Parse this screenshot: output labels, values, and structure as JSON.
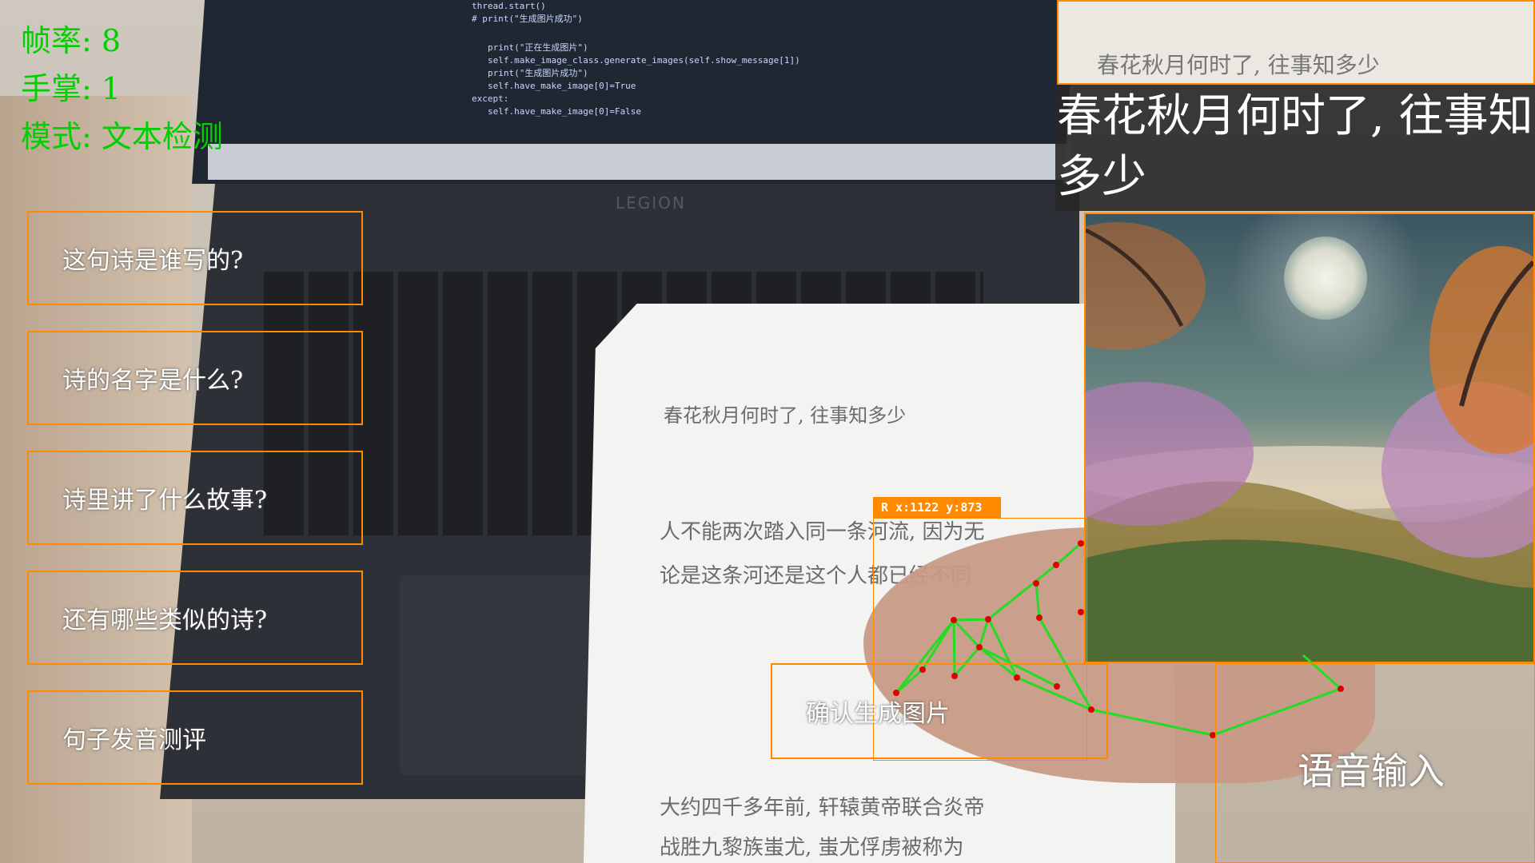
{
  "hud": {
    "fps_text": "帧率: 8",
    "palms_text": "手掌: 1",
    "mode_text": "模式: 文本检测"
  },
  "questions": [
    "这句诗是谁写的?",
    "诗的名字是什么?",
    "诗里讲了什么故事?",
    "还有哪些类似的诗?",
    "句子发音测评"
  ],
  "ocr": {
    "crop_text": "春花秋月何时了, 往事知多少",
    "result_text": "春花秋月何时了, 往事知多少"
  },
  "hand_tracking": {
    "label": "R x:1122 y:873"
  },
  "buttons": {
    "confirm_label": "确认生成图片",
    "voice_label": "语音输入"
  },
  "background": {
    "laptop_brand": "LEGION",
    "paper_lines": [
      "春花秋月何时了, 往事知多少",
      "人不能两次踏入同一条河流, 因为无",
      "论是这条河还是这个人都已经不同",
      "大约四千多年前, 轩辕黄帝联合炎帝",
      "战胜九黎族蚩尤, 蚩尤俘虏被称为"
    ],
    "code_lines": [
      "thread.start()",
      "# print(\"生成图片成功\")",
      "print(\"正在生成图片\")",
      "self.make_image_class.generate_images(self.show_message[1])",
      "print(\"生成图片成功\")",
      "self.have_make_image[0]=True",
      "except:",
      "self.have_make_image[0]=False"
    ]
  },
  "colors": {
    "hud_green": "#00d000",
    "box_orange": "#ff8a00",
    "landmark_red": "#e00000",
    "skeleton_green": "#22dd22"
  }
}
